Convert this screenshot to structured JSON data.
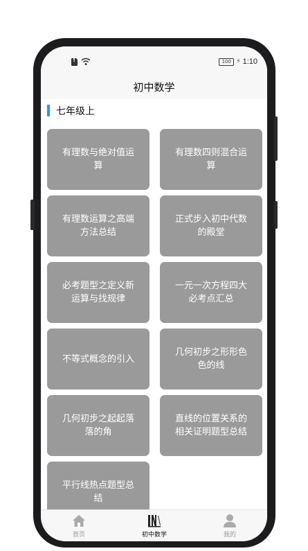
{
  "status_bar": {
    "battery": "100",
    "time": "1:10"
  },
  "header": {
    "title": "初中数学"
  },
  "section": {
    "title": "七年级上"
  },
  "topics": [
    "有理数与绝对值运算",
    "有理数四则混合运算",
    "有理数运算之高端方法总结",
    "正式步入初中代数的殿堂",
    "必考题型之定义新运算与找规律",
    "一元一次方程四大必考点汇总",
    "不等式概念的引入",
    "几何初步之形形色色的线",
    "几何初步之起起落落的角",
    "直线的位置关系的相关证明题型总结",
    "平行线热点题型总结"
  ],
  "tabs": [
    {
      "label": "首页",
      "icon": "home-icon"
    },
    {
      "label": "初中数学",
      "icon": "math-book-icon"
    },
    {
      "label": "我的",
      "icon": "user-icon"
    }
  ],
  "colors": {
    "accent": "#2a9bd8",
    "tile": "#9a9a9a",
    "bar": "#f7f7f7",
    "frame": "#1c1c1e"
  }
}
